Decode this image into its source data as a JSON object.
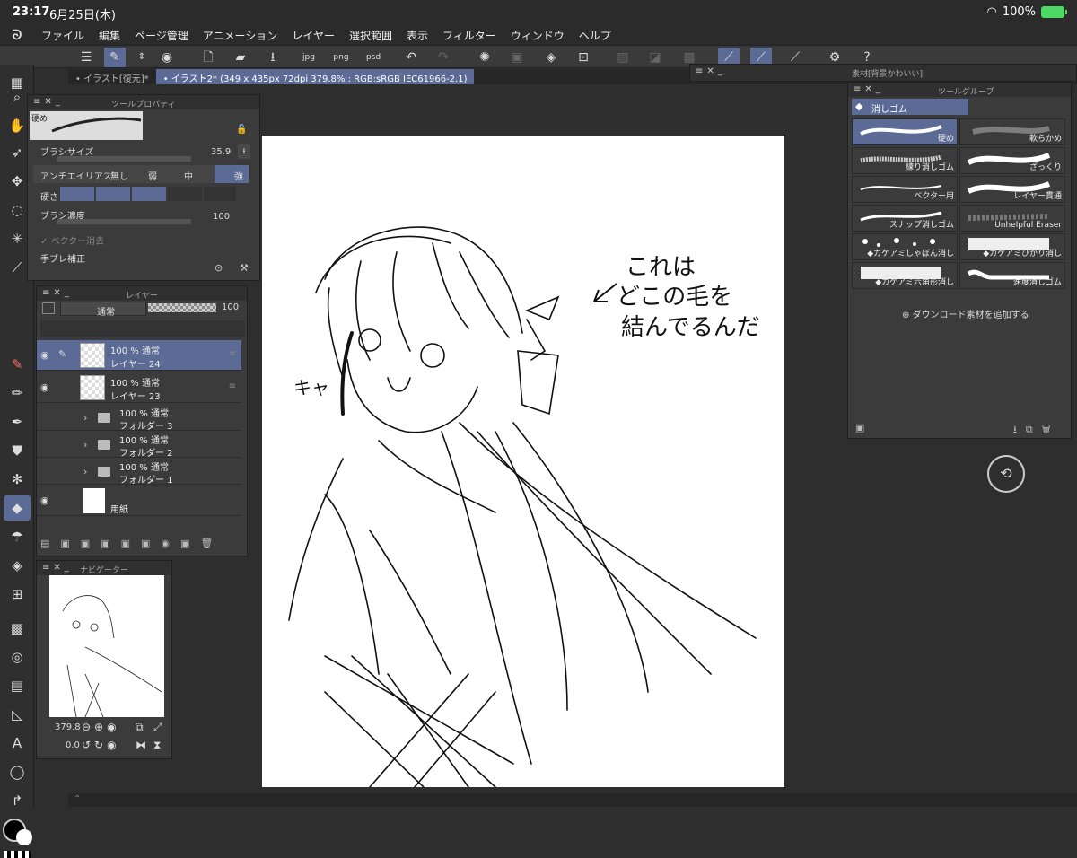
{
  "status": {
    "time": "23:17",
    "date": "6月25日(木)",
    "battery": "100%"
  },
  "menu": [
    "ファイル",
    "編集",
    "ページ管理",
    "アニメーション",
    "レイヤー",
    "選択範囲",
    "表示",
    "フィルター",
    "ウィンドウ",
    "ヘルプ"
  ],
  "tabs": [
    {
      "label": "• イラスト[復元]*"
    },
    {
      "label": "• イラスト2* (349 x 435px 72dpi 379.8% : RGB:sRGB IEC61966-2.1)"
    }
  ],
  "tool_property": {
    "title": "ツールプロパティ",
    "preset": "硬め",
    "brush_size_label": "ブラシサイズ",
    "brush_size_value": "35.9",
    "antialias_label": "アンチエイリアス",
    "antialias_options": [
      "無し",
      "弱",
      "中",
      "強"
    ],
    "hardness_label": "硬さ",
    "density_label": "ブラシ濃度",
    "density_value": "100",
    "vector_erase_label": "ベクター消去",
    "stabilization_label": "手ブレ補正"
  },
  "layers": {
    "title": "レイヤー",
    "blend_mode": "通常",
    "opacity": "100",
    "items": [
      {
        "line1": "100 % 通常",
        "line2": "レイヤー 24",
        "selected": true
      },
      {
        "line1": "100 % 通常",
        "line2": "レイヤー 23",
        "selected": false
      }
    ],
    "folders": [
      {
        "line1": "100 % 通常",
        "line2": "フォルダー 3"
      },
      {
        "line1": "100 % 通常",
        "line2": "フォルダー 2"
      },
      {
        "line1": "100 % 通常",
        "line2": "フォルダー 1"
      }
    ],
    "paper": "用紙"
  },
  "navigator": {
    "title": "ナビゲーター",
    "zoom": "379.8",
    "rotation": "0.0"
  },
  "material": {
    "title": "素材[背景かわいい]"
  },
  "tool_group": {
    "title": "ツールグループ",
    "group_name": "消しゴム",
    "brushes": [
      "硬め",
      "軟らかめ",
      "練り消しゴム",
      "ざっくり",
      "ベクター用",
      "レイヤー貫通",
      "スナップ消しゴム",
      "Unhelpful Eraser",
      "◆カケアミしゃぼん消し",
      "◆カケアミひかり消し",
      "◆カケアミ六角形消し",
      "速度消しゴム"
    ],
    "download_label": "ダウンロード素材を追加する"
  },
  "canvas_text": {
    "line1": "これは",
    "line2": "どこの毛を",
    "line3": "結んでるんだ",
    "kya": "キャ"
  },
  "colors": {
    "accent": "#5b6b96",
    "panel": "#3b3b3b",
    "bg": "#2e2e2e"
  }
}
